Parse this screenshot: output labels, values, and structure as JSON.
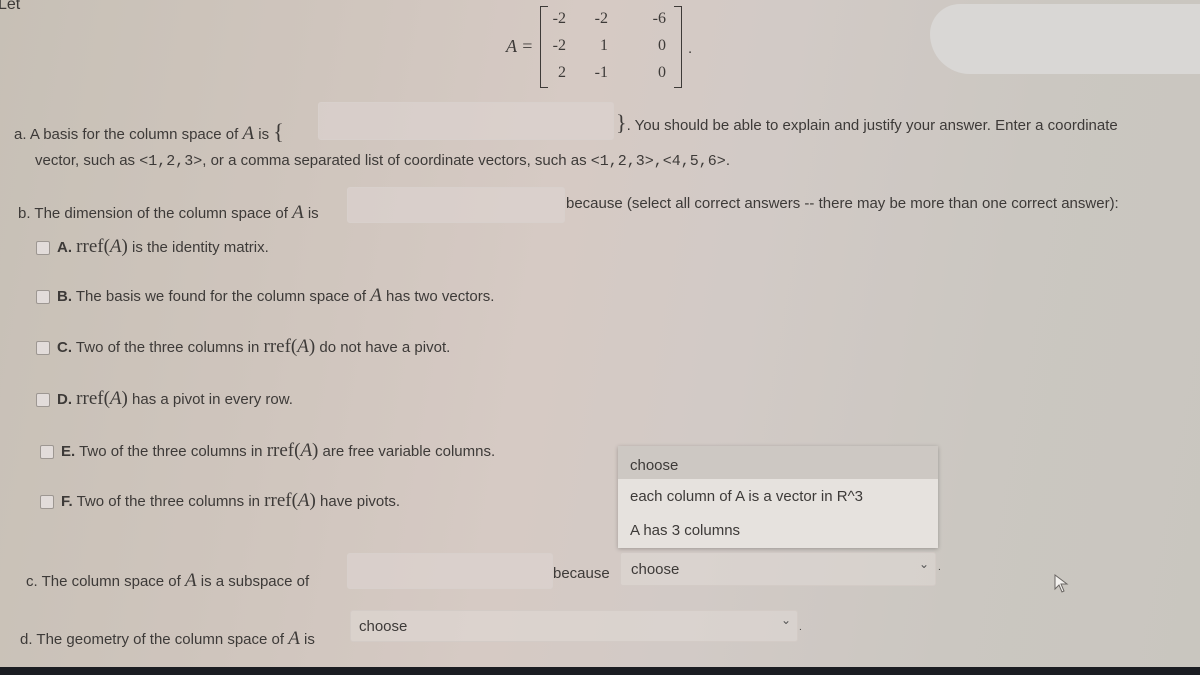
{
  "header": {
    "intro": "Let"
  },
  "matrix": {
    "label": "A =",
    "rows": [
      [
        "-2",
        "-2",
        "-6"
      ],
      [
        "-2",
        "1",
        "0"
      ],
      [
        "2",
        "-1",
        "0"
      ]
    ],
    "trailing": "."
  },
  "part_a": {
    "prefix": "a. A basis for the column space of",
    "var": "A",
    "is": "is",
    "open_brace": "{",
    "close_brace": "}",
    "input_value": "",
    "suffix": ". You should be able to explain and justify your answer. Enter a coordinate",
    "line2_prefix": "vector, such as",
    "example1": "<1,2,3>",
    "line2_mid": ", or a comma separated list of coordinate vectors, such as",
    "example2": "<1,2,3>,<4,5,6>",
    "line2_end": "."
  },
  "part_b": {
    "prefix": "b. The dimension of the column space of",
    "var": "A",
    "is": "is",
    "input_value": "",
    "because": "because (select all correct answers -- there may be more than one correct answer):",
    "options": [
      {
        "letter": "A.",
        "pre": "",
        "rref": "rref(",
        "var": "A",
        "close": ")",
        "post": " is the identity matrix.",
        "checked": false
      },
      {
        "letter": "B.",
        "pre": " The basis we found for the column space of ",
        "var": "A",
        "post": " has two vectors.",
        "checked": false
      },
      {
        "letter": "C.",
        "pre": " Two of the three columns in ",
        "rref": "rref(",
        "var": "A",
        "close": ")",
        "post": " do not have a pivot.",
        "checked": false
      },
      {
        "letter": "D.",
        "pre": " ",
        "rref": "rref(",
        "var": "A",
        "close": ")",
        "post": " has a pivot in every row.",
        "checked": false
      },
      {
        "letter": "E.",
        "pre": " Two of the three columns in ",
        "rref": "rref(",
        "var": "A",
        "close": ")",
        "post": " are free variable columns.",
        "checked": false
      },
      {
        "letter": "F.",
        "pre": " Two of the three columns in ",
        "rref": "rref(",
        "var": "A",
        "close": ")",
        "post": " have pivots.",
        "checked": false
      }
    ]
  },
  "part_c": {
    "prefix": "c. The column space of",
    "var": "A",
    "suffix": "is a subspace of",
    "input_value": "",
    "because": "because",
    "select_value": "choose",
    "dropdown_open": true,
    "dropdown_options": [
      "choose",
      "each column of A is a vector in R^3",
      "A has 3 columns"
    ],
    "trailing": "."
  },
  "part_d": {
    "prefix": "d. The geometry of the column space of",
    "var": "A",
    "is": "is",
    "select_value": "choose",
    "trailing": "."
  },
  "icons": {
    "chevron": "⌄",
    "cursor": "mouse-pointer"
  }
}
